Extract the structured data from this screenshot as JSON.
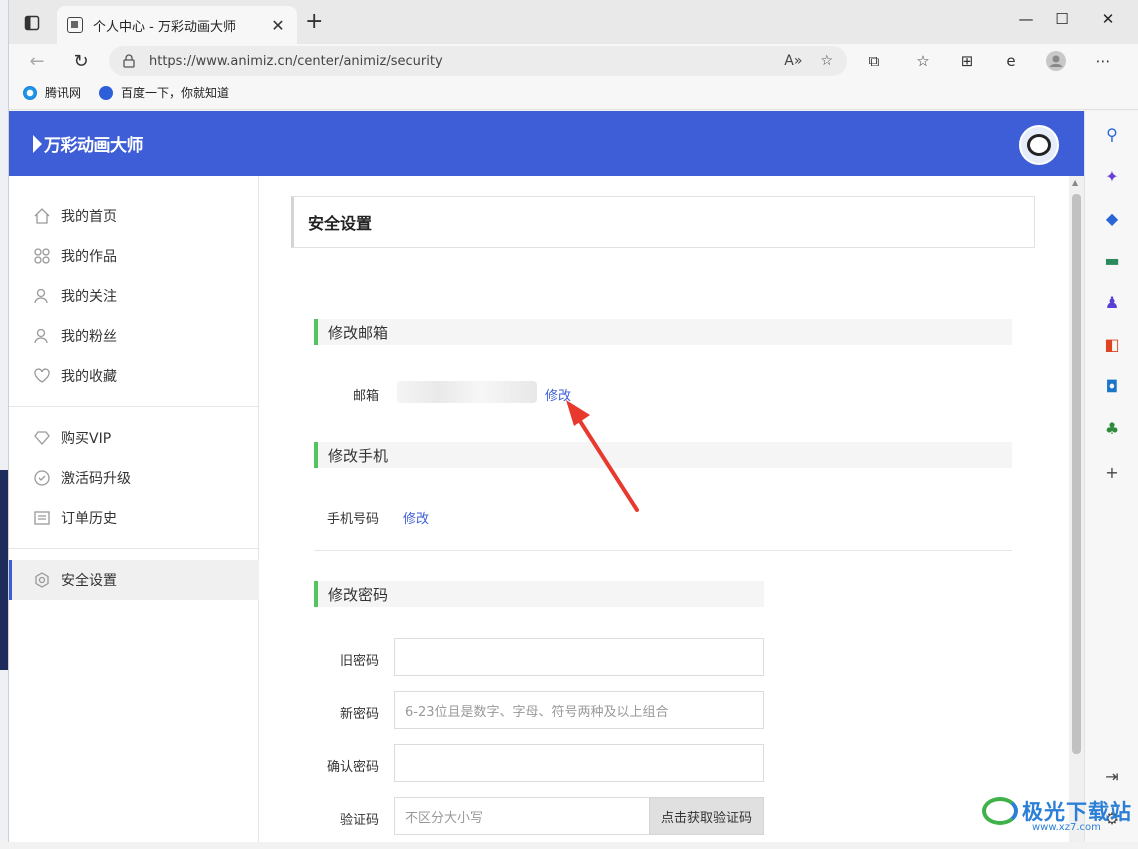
{
  "browser": {
    "tab_title": "个人中心 - 万彩动画大师",
    "url": "https://www.animiz.cn/center/animiz/security",
    "favorites": [
      "腾讯网",
      "百度一下，你就知道"
    ]
  },
  "site": {
    "logo_text": "万彩动画大师",
    "brand_color": "#3d5ed6",
    "accent_color": "#54c45e"
  },
  "sidebar": {
    "items": [
      {
        "label": "我的首页",
        "icon": "home-icon"
      },
      {
        "label": "我的作品",
        "icon": "grid-icon"
      },
      {
        "label": "我的关注",
        "icon": "user-icon"
      },
      {
        "label": "我的粉丝",
        "icon": "user-icon"
      },
      {
        "label": "我的收藏",
        "icon": "heart-icon"
      },
      {
        "label": "购买VIP",
        "icon": "diamond-icon"
      },
      {
        "label": "激活码升级",
        "icon": "ticket-icon"
      },
      {
        "label": "订单历史",
        "icon": "list-icon"
      },
      {
        "label": "安全设置",
        "icon": "gear-icon",
        "active": true
      }
    ]
  },
  "main": {
    "section_title": "安全设置",
    "email": {
      "heading": "修改邮箱",
      "label": "邮箱",
      "edit_label": "修改"
    },
    "phone": {
      "heading": "修改手机",
      "label": "手机号码",
      "edit_label": "修改"
    },
    "password": {
      "heading": "修改密码",
      "old_label": "旧密码",
      "new_label": "新密码",
      "new_placeholder": "6-23位且是数字、字母、符号两种及以上组合",
      "confirm_label": "确认密码",
      "code_label": "验证码",
      "code_placeholder": "不区分大小写",
      "get_code_button": "点击获取验证码"
    }
  },
  "watermark": {
    "text": "极光下载站",
    "sub": "www.xz7.com"
  }
}
